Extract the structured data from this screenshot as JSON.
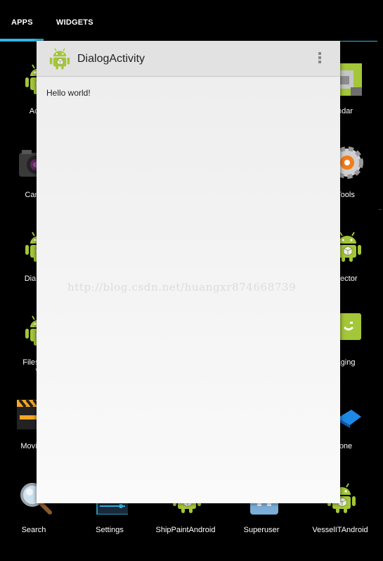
{
  "tabs": {
    "apps": "APPS",
    "widgets": "WIDGETS"
  },
  "apps": {
    "row1_left": "Actio",
    "row1_right": "ndar",
    "row2_left": "Cam",
    "row2_right": "Tools",
    "row3_left": "DialogA",
    "row3_right": "elector",
    "row4_left_line1": "Fileselec",
    "row4_left_line2": "V",
    "row4_right": "aging",
    "row5_left": "Movie",
    "row5_right": "one",
    "bottom": [
      "Search",
      "Settings",
      "ShipPaintAndroid",
      "Superuser",
      "VesselITAndroid"
    ]
  },
  "dialog": {
    "title": "DialogActivity",
    "body_text": "Hello world!",
    "watermark": "http://blog.csdn.net/huangxr874668739"
  },
  "colors": {
    "accent": "#33b5e5",
    "android_green": "#a4c639"
  }
}
